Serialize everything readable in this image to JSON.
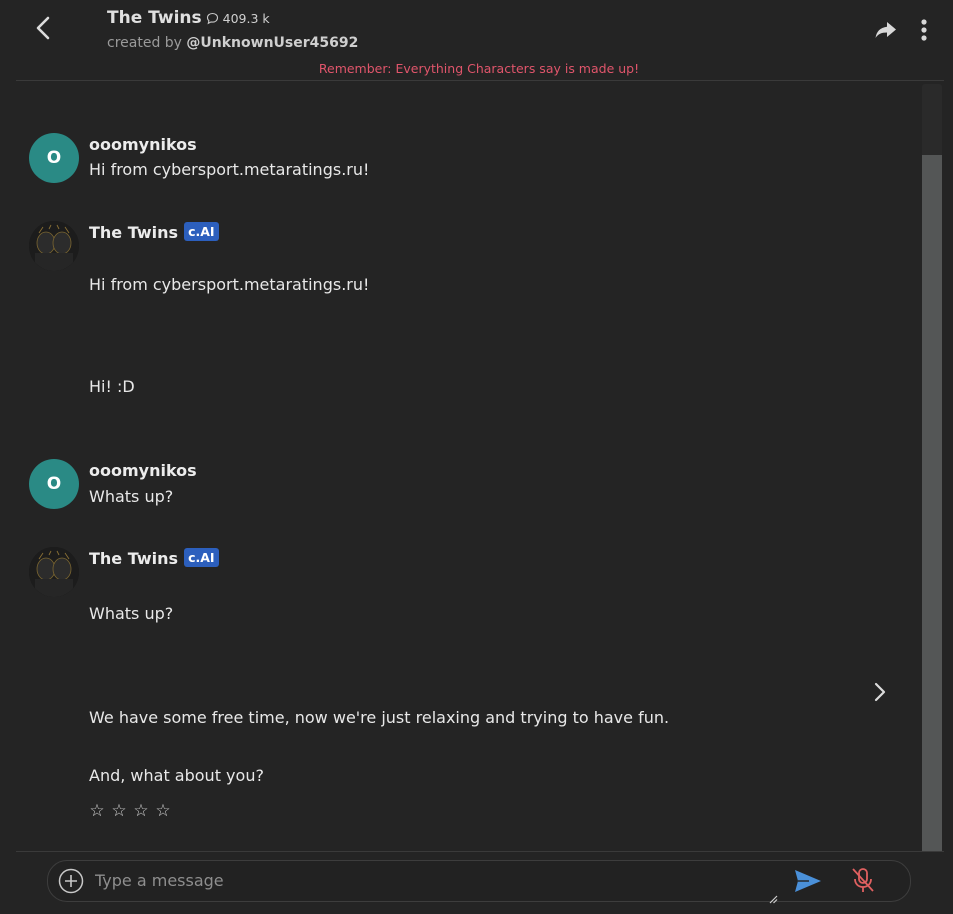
{
  "header": {
    "title": "The Twins",
    "chat_count": "409.3 k",
    "created_by_prefix": "created by ",
    "creator": "@UnknownUser45692",
    "disclaimer": "Remember: Everything Characters say is made up!"
  },
  "messages": [
    {
      "sender": "ooomynikos",
      "avatar_letter": "O",
      "lines": [
        "Hi from cybersport.metaratings.ru!"
      ]
    },
    {
      "sender": "The Twins",
      "badge": "c.AI",
      "lines": [
        "Hi from cybersport.metaratings.ru!",
        "Hi! :D"
      ]
    },
    {
      "sender": "ooomynikos",
      "avatar_letter": "O",
      "lines": [
        "Whats up?"
      ]
    },
    {
      "sender": "The Twins",
      "badge": "c.AI",
      "lines": [
        "Whats up?",
        "We have some free time, now we're just relaxing and trying to have fun.",
        "And, what about you?"
      ]
    }
  ],
  "rating": {
    "stars": [
      "☆",
      "☆",
      "☆",
      "☆"
    ]
  },
  "composer": {
    "placeholder": "Type a message"
  },
  "colors": {
    "background": "#242424",
    "accent_send": "#4a90d9",
    "mic_muted": "#e06060",
    "user_avatar": "#2a8a85",
    "badge": "#2c5fbd",
    "disclaimer": "#e0556b"
  },
  "icons": {
    "back": "chevron-left-icon",
    "chat": "chat-bubble-icon",
    "share": "share-arrow-icon",
    "more": "vertical-dots-icon",
    "next": "chevron-right-icon",
    "add": "plus-circle-icon",
    "send": "send-icon",
    "mic": "mic-off-icon"
  }
}
